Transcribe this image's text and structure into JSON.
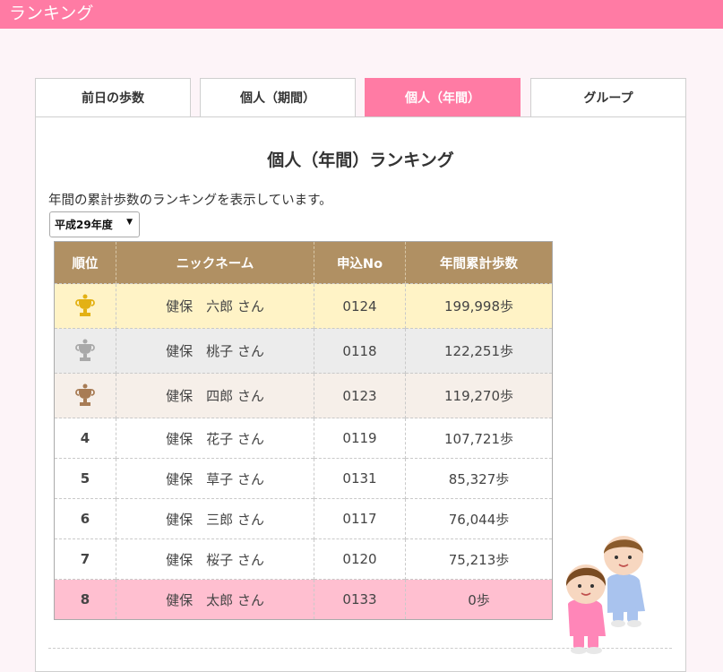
{
  "header": {
    "title": "ランキング",
    "bg_color": "#ff7ba4"
  },
  "tabs": [
    {
      "label": "前日の歩数",
      "active": false
    },
    {
      "label": "個人（期間）",
      "active": false
    },
    {
      "label": "個人（年間）",
      "active": true
    },
    {
      "label": "グループ",
      "active": false
    }
  ],
  "panel": {
    "title": "個人（年間）ランキング",
    "description": "年間の累計歩数のランキングを表示しています。",
    "year_select": {
      "selected": "平成29年度"
    }
  },
  "table": {
    "headers": [
      "順位",
      "ニックネーム",
      "申込No",
      "年間累計歩数"
    ],
    "rows": [
      {
        "rank": "1",
        "trophy": "gold",
        "name": "健保　六郎 さん",
        "no": "0124",
        "steps": "199,998歩"
      },
      {
        "rank": "2",
        "trophy": "silver",
        "name": "健保　桃子 さん",
        "no": "0118",
        "steps": "122,251歩"
      },
      {
        "rank": "3",
        "trophy": "bronze",
        "name": "健保　四郎 さん",
        "no": "0123",
        "steps": "119,270歩"
      },
      {
        "rank": "4",
        "name": "健保　花子 さん",
        "no": "0119",
        "steps": "107,721歩"
      },
      {
        "rank": "5",
        "name": "健保　草子 さん",
        "no": "0131",
        "steps": "85,327歩"
      },
      {
        "rank": "6",
        "name": "健保　三郎 さん",
        "no": "0117",
        "steps": "76,044歩"
      },
      {
        "rank": "7",
        "name": "健保　桜子 さん",
        "no": "0120",
        "steps": "75,213歩"
      },
      {
        "rank": "8",
        "name": "健保　太郎 さん",
        "no": "0133",
        "steps": "0歩",
        "highlight": true
      }
    ]
  },
  "colors": {
    "accent": "#ff7ba4",
    "table_header": "#b09063",
    "gold_row": "#fff3c6",
    "silver_row": "#ececec",
    "bronze_row": "#f6efe9",
    "self_row": "#ffbfd0"
  },
  "icons": {
    "gold": "gold-trophy-icon",
    "silver": "silver-trophy-icon",
    "bronze": "bronze-trophy-icon",
    "mascot": "walking-couple-mascot"
  }
}
